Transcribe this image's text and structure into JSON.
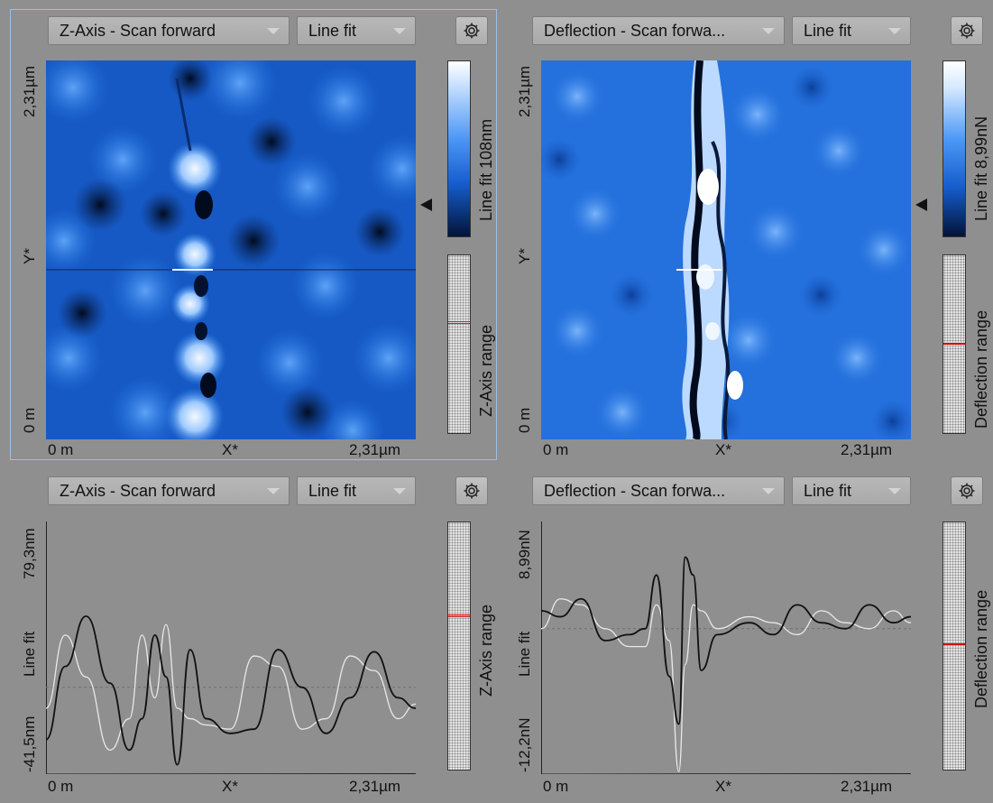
{
  "panels": {
    "tl": {
      "channel": "Z-Axis - Scan forward",
      "filter": "Line fit",
      "y_min": "0 m",
      "y_mid": "Y*",
      "y_max": "2,31µm",
      "x_min": "0 m",
      "x_mid": "X*",
      "x_max": "2,31µm",
      "colorbar_label": "Line fit 108nm",
      "range_label": "Z-Axis range"
    },
    "tr": {
      "channel": "Deflection - Scan forwa...",
      "filter": "Line fit",
      "y_min": "0 m",
      "y_mid": "Y*",
      "y_max": "2,31µm",
      "x_min": "0 m",
      "x_mid": "X*",
      "x_max": "2,31µm",
      "colorbar_label": "Line fit 8,99nN",
      "range_label": "Deflection range"
    },
    "bl": {
      "channel": "Z-Axis - Scan forward",
      "filter": "Line fit",
      "y_min": "-41,5nm",
      "y_mid": "Line fit",
      "y_max": "79,3nm",
      "x_min": "0 m",
      "x_mid": "X*",
      "x_max": "2,31µm",
      "range_label": "Z-Axis range"
    },
    "br": {
      "channel": "Deflection - Scan forwa...",
      "filter": "Line fit",
      "y_min": "-12,2nN",
      "y_mid": "Line fit",
      "y_max": "8,99nN",
      "x_min": "0 m",
      "x_mid": "X*",
      "x_max": "2,31µm",
      "range_label": "Deflection range"
    }
  },
  "icons": {
    "settings": "gear-icon",
    "dropdown": "chevron-down-icon",
    "marker": "triangle-left-icon"
  },
  "colors": {
    "background": "#8f8f8f",
    "image_dark": "#020b1e",
    "image_mid": "#1f6fe0",
    "image_light": "#eef6ff",
    "trace_forward": "#111111",
    "trace_backward": "#e8e8e8",
    "range_marker": "#d22222"
  },
  "chart_data": [
    {
      "type": "line",
      "panel": "Z-Axis line profile",
      "xlabel": "X*",
      "ylabel": "Line fit",
      "xlim": [
        0,
        2.31
      ],
      "ylim": [
        -41.5,
        79.3
      ],
      "x": [
        0.0,
        0.12,
        0.25,
        0.4,
        0.52,
        0.6,
        0.68,
        0.75,
        0.82,
        0.9,
        1.0,
        1.15,
        1.3,
        1.45,
        1.6,
        1.75,
        1.9,
        2.05,
        2.2,
        2.31
      ],
      "series": [
        {
          "values": [
            -25,
            10,
            34,
            2,
            -30,
            -15,
            25,
            5,
            -37,
            18,
            -15,
            -22,
            -20,
            18,
            0,
            -22,
            -5,
            17,
            -5,
            -10
          ]
        },
        {
          "values": [
            -10,
            25,
            5,
            -30,
            -15,
            25,
            -5,
            30,
            -10,
            -15,
            -18,
            -20,
            15,
            10,
            -20,
            -15,
            15,
            8,
            -15,
            -8
          ]
        }
      ]
    },
    {
      "type": "line",
      "panel": "Deflection line profile",
      "xlabel": "X*",
      "ylabel": "Line fit",
      "xlim": [
        0,
        2.31
      ],
      "ylim": [
        -12.2,
        8.99
      ],
      "x": [
        0.0,
        0.12,
        0.25,
        0.4,
        0.55,
        0.65,
        0.72,
        0.8,
        0.86,
        0.9,
        0.95,
        1.0,
        1.1,
        1.3,
        1.45,
        1.6,
        1.75,
        1.9,
        2.05,
        2.2,
        2.31
      ],
      "series": [
        {
          "values": [
            1.5,
            1.0,
            2.5,
            -1.0,
            -0.5,
            0.0,
            4.5,
            -4.0,
            -8.0,
            6.0,
            4.5,
            -3.5,
            -0.5,
            0.5,
            -0.5,
            2.0,
            0.5,
            0.0,
            2.0,
            0.5,
            1.0
          ]
        },
        {
          "values": [
            0.0,
            2.5,
            2.0,
            0.0,
            -1.5,
            -1.5,
            2.0,
            -1.0,
            -12.0,
            -3.0,
            2.0,
            1.5,
            0.0,
            1.0,
            0.5,
            -0.5,
            1.5,
            0.5,
            0.0,
            1.5,
            0.5
          ]
        }
      ]
    }
  ]
}
